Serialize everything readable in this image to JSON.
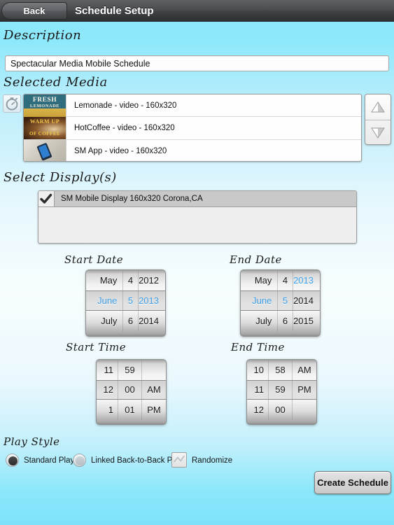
{
  "titlebar": {
    "back_label": "Back",
    "title": "Schedule Setup"
  },
  "description": {
    "heading": "Description",
    "value": "Spectacular Media Mobile Schedule",
    "placeholder": "Description"
  },
  "selected_media": {
    "heading": "Selected Media",
    "timer_icon": "stopwatch-icon",
    "items": [
      {
        "label": "Lemonade - video - 160x320",
        "thumb_text": "FRESH LEMONADE"
      },
      {
        "label": "HotCoffee - video - 160x320",
        "thumb_text": "WARM UP OF COFFEE"
      },
      {
        "label": "SM App - video - 160x320",
        "thumb_text": ""
      }
    ],
    "move_up_icon": "triangle-up-icon",
    "move_down_icon": "triangle-down-icon"
  },
  "select_displays": {
    "heading": "Select Display(s)",
    "items": [
      {
        "label": "SM Mobile Display  160x320  Corona,CA",
        "checked": true
      }
    ]
  },
  "start_date": {
    "heading": "Start Date",
    "rows": [
      {
        "month": "May",
        "day": "4",
        "year": "2012",
        "selected": false,
        "blue": []
      },
      {
        "month": "June",
        "day": "5",
        "year": "2013",
        "selected": true,
        "blue": [
          "month",
          "day",
          "year"
        ]
      },
      {
        "month": "July",
        "day": "6",
        "year": "2014",
        "selected": false,
        "blue": []
      }
    ],
    "value": "June 5 2013"
  },
  "end_date": {
    "heading": "End Date",
    "rows": [
      {
        "month": "May",
        "day": "4",
        "year": "2013",
        "selected": false,
        "blue": [
          "year"
        ]
      },
      {
        "month": "June",
        "day": "5",
        "year": "2014",
        "selected": true,
        "blue": [
          "month",
          "day"
        ]
      },
      {
        "month": "July",
        "day": "6",
        "year": "2015",
        "selected": false,
        "blue": []
      }
    ],
    "value": "June 5 2014"
  },
  "start_time": {
    "heading": "Start Time",
    "rows": [
      {
        "hour": "11",
        "minute": "59",
        "meridiem": "",
        "selected": false
      },
      {
        "hour": "12",
        "minute": "00",
        "meridiem": "AM",
        "selected": true
      },
      {
        "hour": "1",
        "minute": "01",
        "meridiem": "PM",
        "selected": false
      }
    ],
    "value": "12:00 AM"
  },
  "end_time": {
    "heading": "End Time",
    "rows": [
      {
        "hour": "10",
        "minute": "58",
        "meridiem": "AM",
        "selected": false
      },
      {
        "hour": "11",
        "minute": "59",
        "meridiem": "PM",
        "selected": true
      },
      {
        "hour": "12",
        "minute": "00",
        "meridiem": "",
        "selected": false
      }
    ],
    "value": "11:59 PM"
  },
  "play_style": {
    "heading": "Play Style",
    "standard_label": "Standard Play",
    "standard_selected": true,
    "linked_label": "Linked Back-to-Back Play",
    "linked_selected": false,
    "randomize_label": "Randomize",
    "randomize_checked": false
  },
  "actions": {
    "create_label": "Create Schedule"
  },
  "colors": {
    "background_top": "#8ee8fb",
    "background_mid": "#f7fdfe",
    "titlebar": "#4a4c4f",
    "picker_highlight_text": "#3c9ee8",
    "selected_row": "#c9c9c9"
  }
}
